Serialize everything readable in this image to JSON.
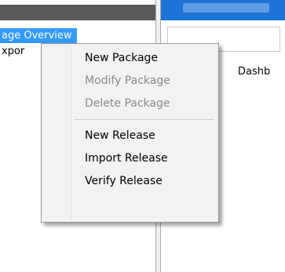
{
  "left_panel": {
    "selected_item": "age Overview",
    "item2": "xpor"
  },
  "right_panel": {
    "text": "Dashb"
  },
  "context_menu": {
    "items": [
      {
        "label": "New Package",
        "enabled": true
      },
      {
        "label": "Modify Package",
        "enabled": false
      },
      {
        "label": "Delete Package",
        "enabled": false
      },
      {
        "label": "New Release",
        "enabled": true
      },
      {
        "label": "Import Release",
        "enabled": true
      },
      {
        "label": "Verify Release",
        "enabled": true
      }
    ]
  }
}
